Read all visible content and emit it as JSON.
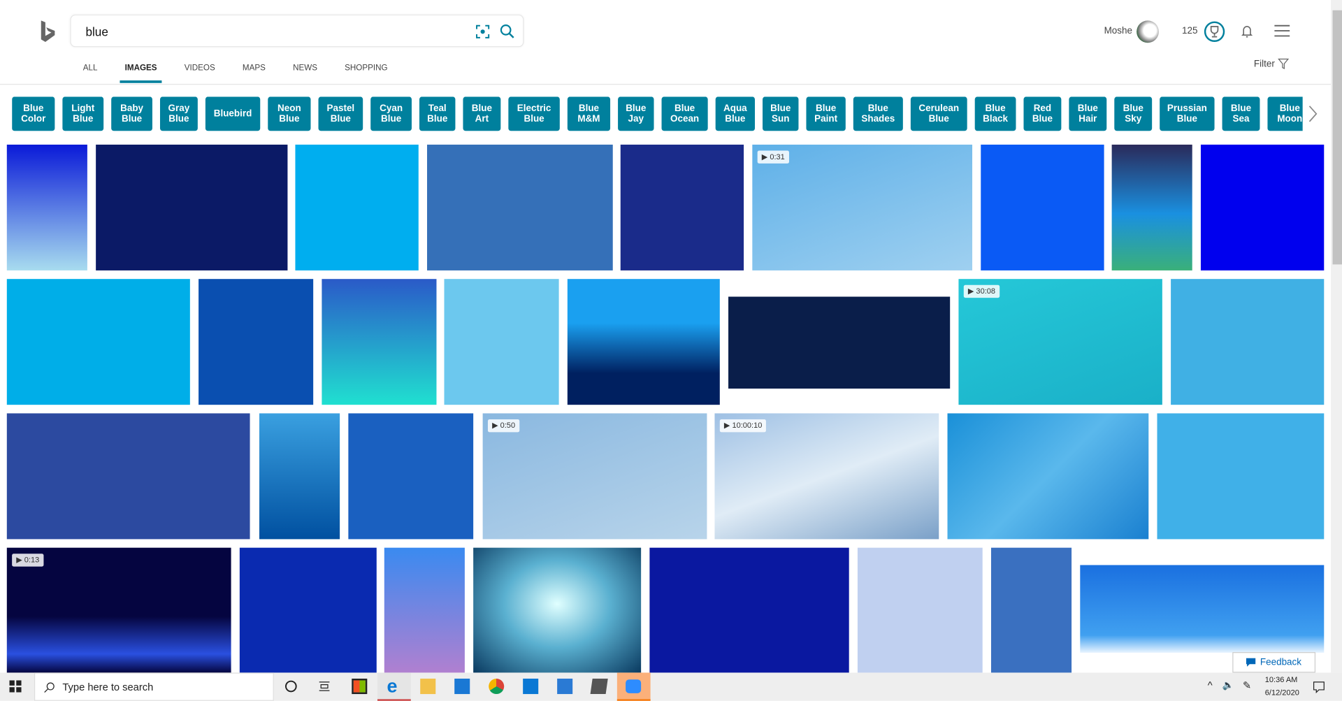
{
  "header": {
    "search_query": "blue",
    "user_name": "Moshe",
    "rewards_points": "125",
    "filter_label": "Filter"
  },
  "tabs": [
    "ALL",
    "IMAGES",
    "VIDEOS",
    "MAPS",
    "NEWS",
    "SHOPPING"
  ],
  "active_tab": "IMAGES",
  "chips": [
    "Blue\nColor",
    "Light\nBlue",
    "Baby\nBlue",
    "Gray\nBlue",
    "Bluebird",
    "Neon\nBlue",
    "Pastel\nBlue",
    "Cyan\nBlue",
    "Teal\nBlue",
    "Blue\nArt",
    "Electric\nBlue",
    "Blue\nM&M",
    "Blue\nJay",
    "Blue\nOcean",
    "Aqua\nBlue",
    "Blue\nSun",
    "Blue\nPaint",
    "Blue\nShades",
    "Cerulean\nBlue",
    "Blue\nBlack",
    "Red\nBlue",
    "Blue\nHair",
    "Blue\nSky",
    "Prussian\nBlue",
    "Blue\nSea",
    "Blue\nMoon",
    ""
  ],
  "chip_color": "#00809d",
  "videos": {
    "r1": "0:31",
    "r2": "30:08",
    "r3a": "0:50",
    "r3b": "10:00:10",
    "r4": "0:13"
  },
  "feedback_label": "Feedback",
  "taskbar": {
    "search_placeholder": "Type here to search",
    "time": "10:36 AM",
    "date": "6/12/2020"
  }
}
